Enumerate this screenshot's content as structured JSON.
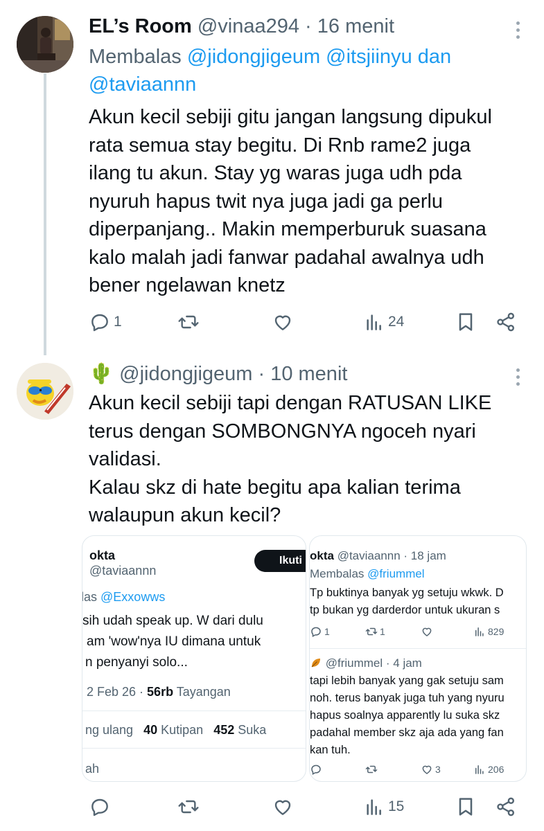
{
  "tweet1": {
    "display_name": "EL’s Room",
    "meta": "@vinaa294 · 16 menit",
    "reply_prefix": "Membalas",
    "reply_mentions": "@jidongjigeum @itsjiinyu",
    "reply_and": "dan",
    "reply_last": "@taviaannn",
    "text": "Akun kecil sebiji gitu jangan langsung dipukul\nrata semua stay begitu. Di Rnb rame2 juga\nilang tu akun. Stay yg waras juga udh pda\nnyuruh hapus twit nya juga jadi ga perlu\ndiperpanjang.. Makin memperburuk suasana\nkalo malah jadi fanwar padahal awalnya udh\nbener ngelawan knetz",
    "reply_count": "1",
    "retweet_count": "",
    "like_count": "",
    "view_count": "24"
  },
  "tweet2": {
    "emoji": "🌵",
    "meta": "@jidongjigeum · 10 menit",
    "text": "Akun kecil sebiji tapi dengan RATUSAN LIKE\nterus dengan SOMBONGNYA ngoceh nyari\nvalidasi.\nKalau skz di hate begitu apa kalian terima\nwalaupun akun kecil?",
    "reply_count": "",
    "retweet_count": "",
    "like_count": "",
    "view_count": "15"
  },
  "quote_left": {
    "name": "okta",
    "handle": "@taviaannn",
    "follow_label": "Ikuti",
    "reply_prefix": "las",
    "reply_mention": "@Exxowws",
    "lines": [
      "sih udah speak up. W dari dulu",
      "am 'wow'nya IU dimana untuk",
      "n penyanyi solo..."
    ],
    "date": "2 Feb 26 · ",
    "views_value": "56rb",
    "views_label": " Tayangan",
    "stats_prefix": "ng ulang",
    "quotes_value": "40",
    "quotes_label": "Kutipan",
    "likes_value": "452",
    "likes_label": "Suka",
    "bottom_cut": "ah"
  },
  "quote_right": {
    "name": "okta",
    "meta": "@taviaannn · 18 jam",
    "reply_prefix": "Membalas",
    "reply_mention": "@friummel",
    "lines1": [
      "Tp buktinya banyak yg setuju wkwk. D",
      "tp bukan yg darderdor untuk ukuran s"
    ],
    "act1": {
      "reply": "1",
      "retweet": "1",
      "like": "",
      "views": "829"
    },
    "name2_icon": "leaf-icon",
    "meta2": "@friummel · 4 jam",
    "lines2": [
      "tapi lebih banyak yang gak setuju sam",
      "noh. terus banyak juga tuh yang nyuru",
      "hapus soalnya apparently lu suka skz",
      "padahal member skz aja ada yang fan",
      "kan tuh."
    ],
    "act2": {
      "reply": "",
      "retweet": "",
      "like": "3",
      "views": "206"
    }
  },
  "colors": {
    "link": "#1d9bf0",
    "muted": "#536471",
    "text": "#0f1419",
    "thread": "#cfd9de"
  }
}
